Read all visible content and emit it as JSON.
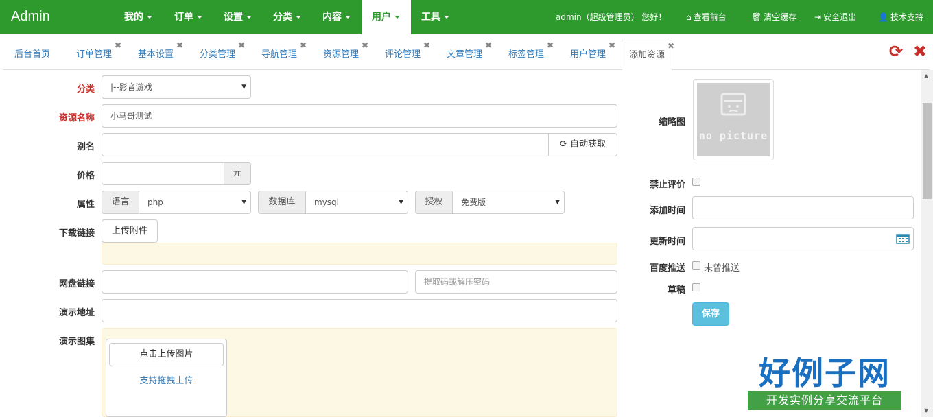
{
  "brand": "Admin",
  "nav": {
    "items": [
      {
        "label": "我的"
      },
      {
        "label": "订单"
      },
      {
        "label": "设置"
      },
      {
        "label": "分类"
      },
      {
        "label": "内容"
      },
      {
        "label": "用户"
      },
      {
        "label": "工具"
      }
    ],
    "active_item": "用户",
    "greeting": "admin（超级管理员） 您好！",
    "links": [
      {
        "label": "查看前台",
        "icon": "home-icon"
      },
      {
        "label": "清空缓存",
        "icon": "trash-icon"
      },
      {
        "label": "安全退出",
        "icon": "logout-icon"
      },
      {
        "label": "技术支持",
        "icon": "user-icon"
      }
    ]
  },
  "tabs": [
    {
      "label": "后台首页"
    },
    {
      "label": "订单管理"
    },
    {
      "label": "基本设置"
    },
    {
      "label": "分类管理"
    },
    {
      "label": "导航管理"
    },
    {
      "label": "资源管理"
    },
    {
      "label": "评论管理"
    },
    {
      "label": "文章管理"
    },
    {
      "label": "标签管理"
    },
    {
      "label": "用户管理"
    },
    {
      "label": "添加资源"
    }
  ],
  "active_tab": "添加资源",
  "tab_tools": {
    "refresh_icon": "refresh-icon",
    "close_icon": "close-icon",
    "refresh_color": "#c9302c",
    "close_color": "#c9302c"
  },
  "form": {
    "category": {
      "label": "分类",
      "value": "|--影音游戏"
    },
    "name": {
      "label": "资源名称",
      "value": "小马哥测试"
    },
    "alias": {
      "label": "别名",
      "value": "",
      "auto_button": "自动获取"
    },
    "price": {
      "label": "价格",
      "value": "",
      "unit": "元"
    },
    "attributes": {
      "label": "属性",
      "language": {
        "addon": "语言",
        "value": "php"
      },
      "database": {
        "addon": "数据库",
        "value": "mysql"
      },
      "license": {
        "addon": "授权",
        "value": "免费版"
      }
    },
    "download": {
      "label": "下载链接",
      "upload_button": "上传附件"
    },
    "netdisk": {
      "label": "网盘链接",
      "value": "",
      "code_placeholder": "提取码或解压密码"
    },
    "demo_url": {
      "label": "演示地址",
      "value": ""
    },
    "gallery": {
      "label": "演示图集",
      "upload_button": "点击上传图片",
      "drag_hint": "支持拖拽上传"
    }
  },
  "sidebar": {
    "thumbnail": {
      "label": "缩略图",
      "image_text": "no picture"
    },
    "disable_comments": {
      "label": "禁止评价",
      "checked": false
    },
    "added_time": {
      "label": "添加时间",
      "value": ""
    },
    "updated_time": {
      "label": "更新时间",
      "value": ""
    },
    "baidu_push": {
      "label": "百度推送",
      "checkbox_text": "未曾推送",
      "checked": false
    },
    "draft": {
      "label": "草稿",
      "checked": false
    },
    "save_button": "保存"
  },
  "watermark": {
    "big": "好例子网",
    "small": "开发实例分享交流平台"
  },
  "colors": {
    "nav_bg": "#2e9a2e",
    "link": "#337ab7",
    "required": "#c9302c",
    "save_btn": "#5bc0de"
  }
}
